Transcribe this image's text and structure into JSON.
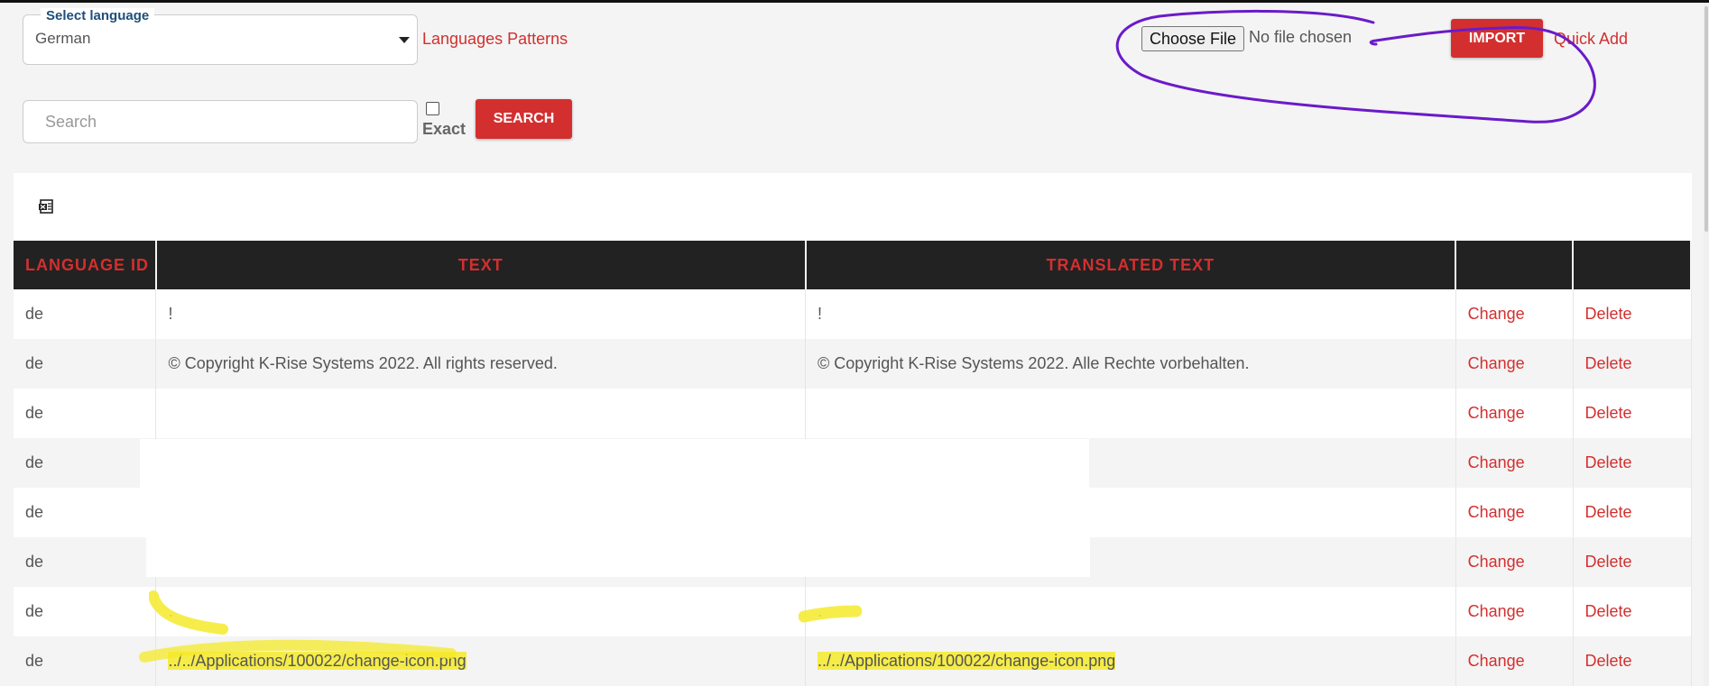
{
  "filter": {
    "select_label": "Select language",
    "selected_language": "German",
    "patterns_link": "Languages Patterns"
  },
  "import": {
    "choose_file_label": "Choose File",
    "file_status": "No file chosen",
    "import_button": "IMPORT",
    "quick_add_link": "Quick Add"
  },
  "search": {
    "placeholder": "Search",
    "exact_label": "Exact",
    "search_button": "SEARCH"
  },
  "toolbar": {
    "export_icon": "export-excel-icon"
  },
  "table": {
    "headers": [
      "LANGUAGE ID",
      "TEXT",
      "TRANSLATED TEXT",
      "",
      ""
    ],
    "rows": [
      {
        "lang": "de",
        "text": "!",
        "translated": "!",
        "change": "Change",
        "delete": "Delete"
      },
      {
        "lang": "de",
        "text": "© Copyright K-Rise Systems 2022. All rights reserved.",
        "translated": "© Copyright K-Rise Systems 2022. Alle Rechte vorbehalten.",
        "change": "Change",
        "delete": "Delete"
      },
      {
        "lang": "de",
        "text": "",
        "translated": "",
        "change": "Change",
        "delete": "Delete"
      },
      {
        "lang": "de",
        "text": "",
        "translated": "",
        "change": "Change",
        "delete": "Delete"
      },
      {
        "lang": "de",
        "text": "",
        "translated": "",
        "change": "Change",
        "delete": "Delete"
      },
      {
        "lang": "de",
        "text": "",
        "translated": "",
        "change": "Change",
        "delete": "Delete"
      },
      {
        "lang": "de",
        "text": ".",
        "translated": ".",
        "change": "Change",
        "delete": "Delete"
      },
      {
        "lang": "de",
        "text": "../../Applications/100022/change-icon.png",
        "translated": "../../Applications/100022/change-icon.png",
        "change": "Change",
        "delete": "Delete"
      }
    ]
  },
  "colors": {
    "accent": "#d32f2f",
    "header_bg": "#222222",
    "annotation_circle": "#6a1bc9",
    "highlighter": "#f5ea2a"
  }
}
